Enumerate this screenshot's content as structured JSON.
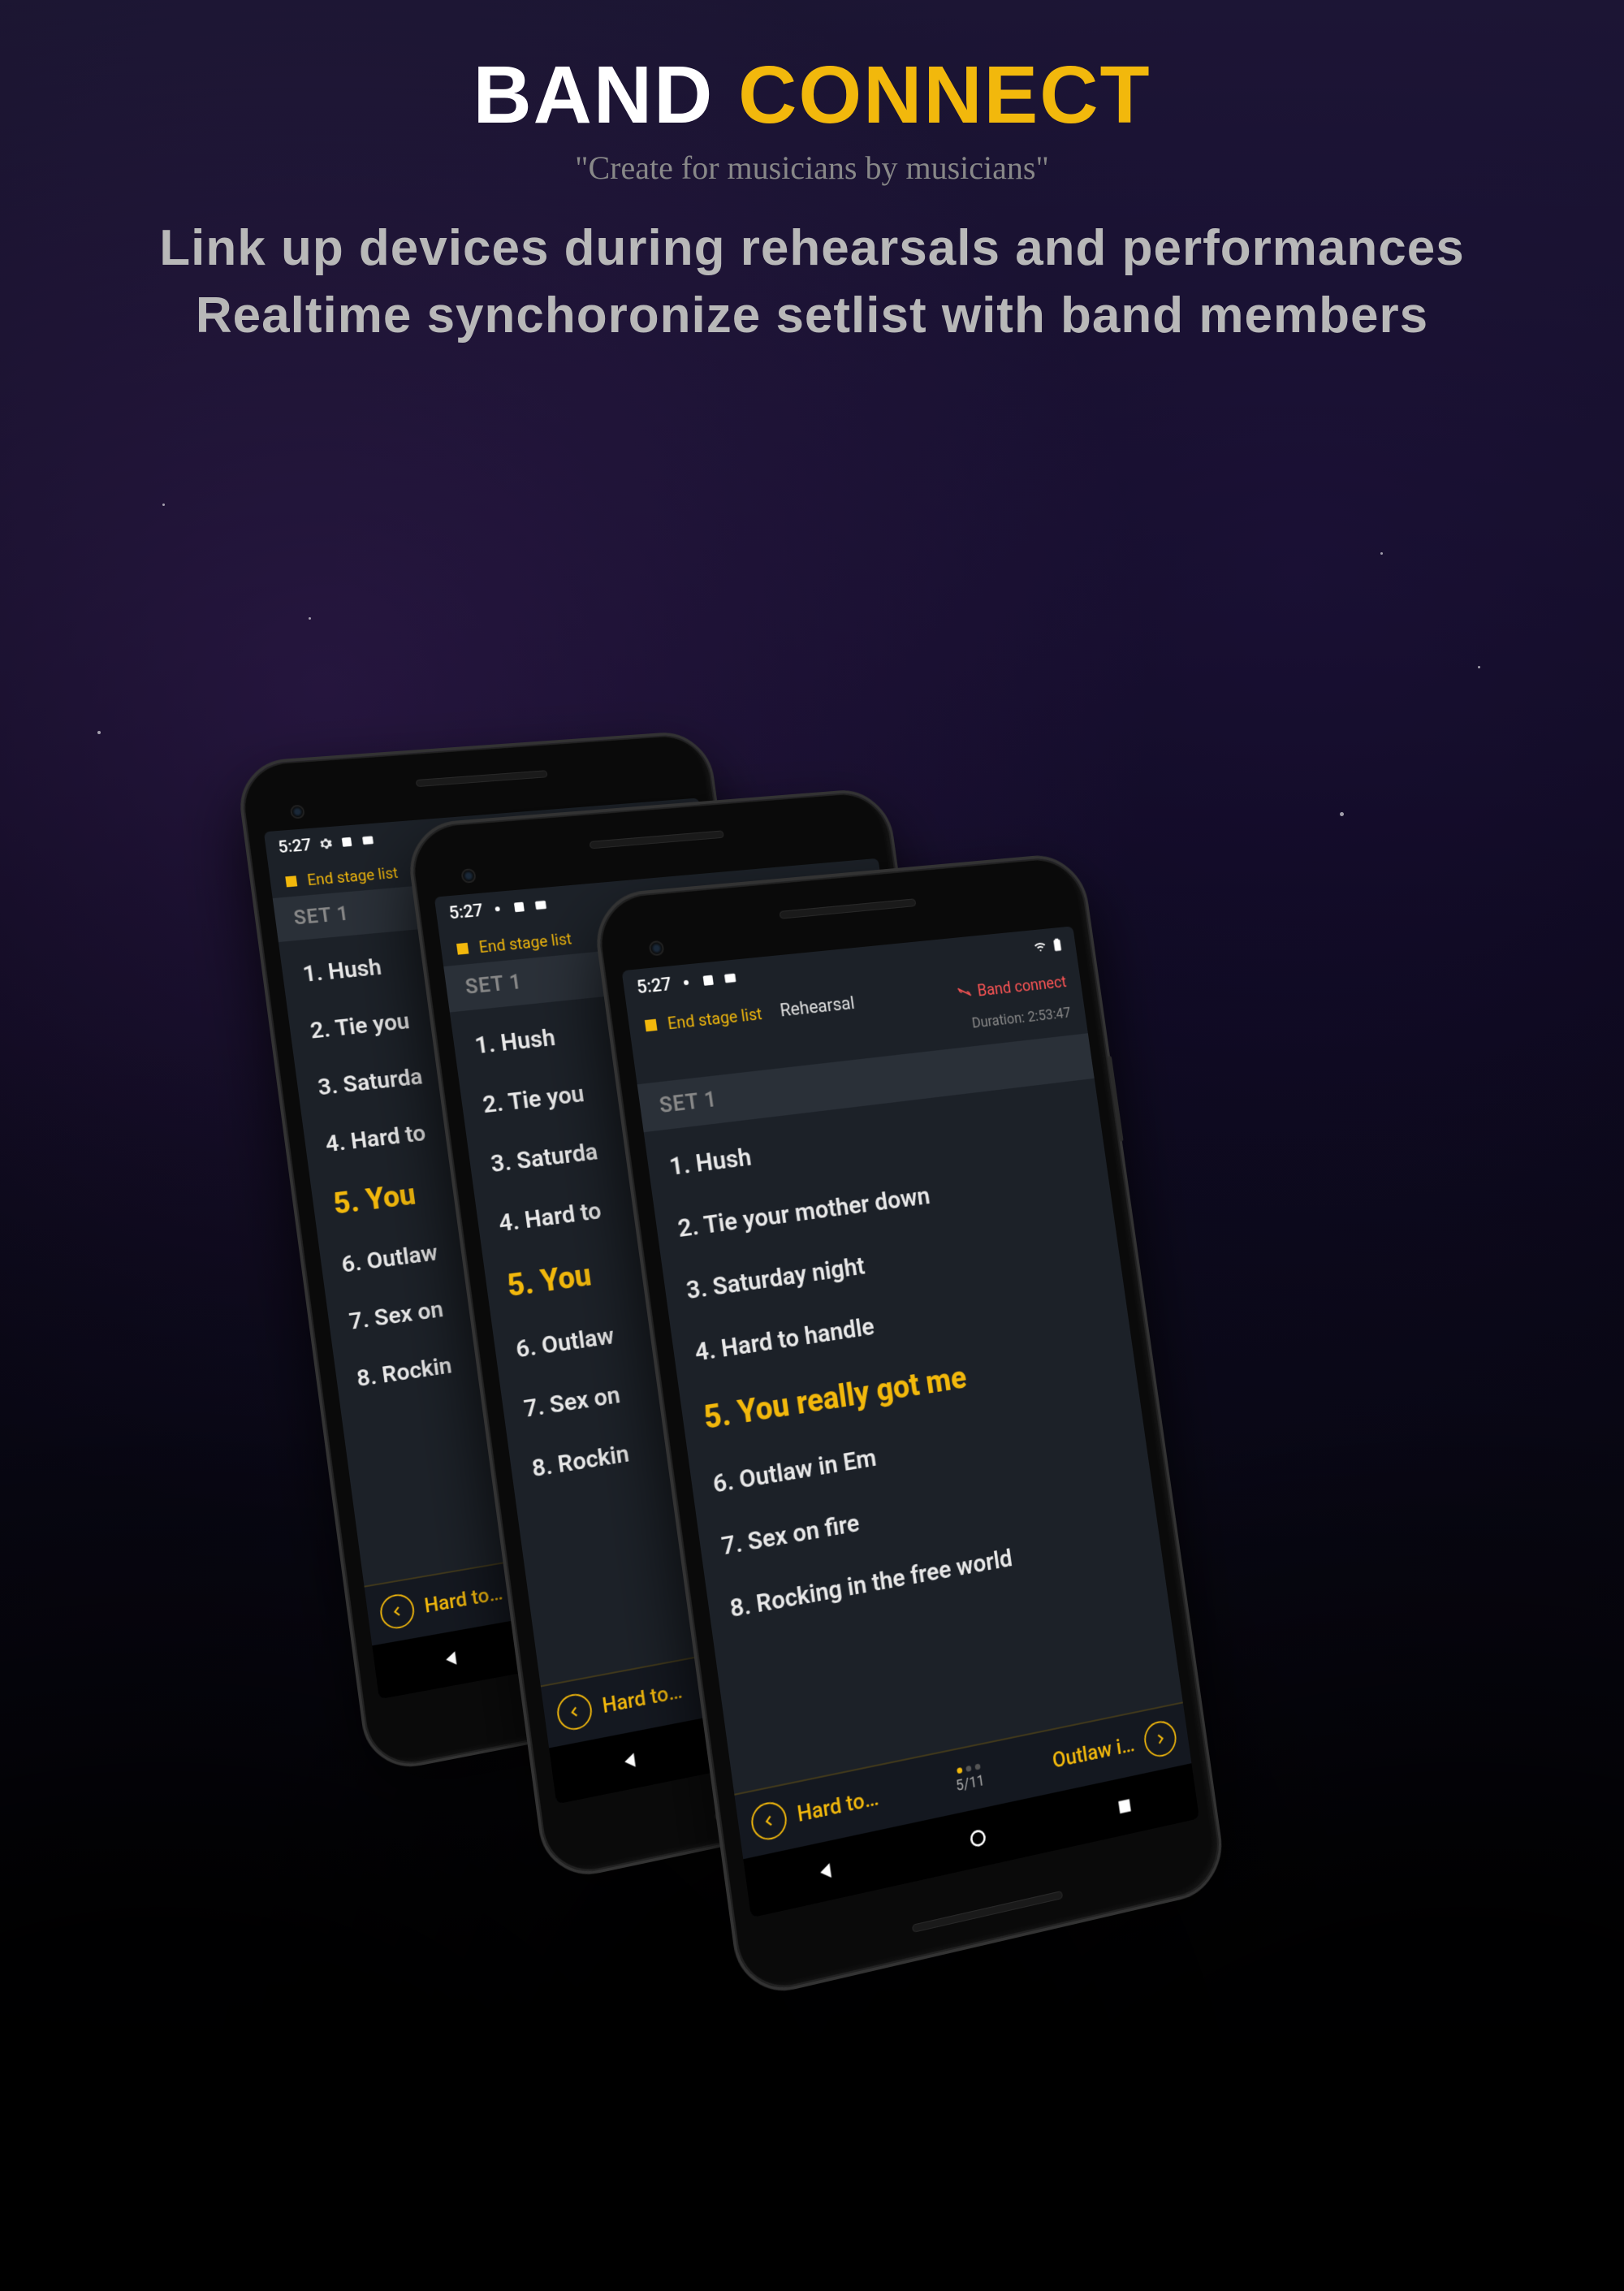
{
  "hero": {
    "title_a": "BAND",
    "title_b": "CONNECT",
    "tagline": "\"Create for musicians by musicians\"",
    "sub1": "Link up devices during rehearsals and performances",
    "sub2": "Realtime synchoronize setlist with band members"
  },
  "phone": {
    "status_time": "5:27",
    "end_stage_label": "End stage list",
    "rehearsal_label": "Rehearsal",
    "band_connect_label": "Band connect",
    "duration_label": "Duration: 2:53:47",
    "set_header": "SET 1",
    "songs": {
      "s1": "1. Hush",
      "s2": "2. Tie your mother down",
      "s2_short": "2. Tie you",
      "s3": "3. Saturday night",
      "s3_short": "3. Saturda",
      "s4": "4. Hard to handle",
      "s4_short": "4. Hard to",
      "s5": "5. You really got me",
      "s5_short": "5. You",
      "s6": "6. Outlaw in Em",
      "s6_short": "6. Outlaw",
      "s7": "7. Sex on fire",
      "s7_short": "7. Sex on",
      "s8": "8. Rocking in the free world",
      "s8_short": "8. Rockin"
    },
    "prev_label": "Hard to…",
    "next_label": "Outlaw i…",
    "pager": "5/11"
  }
}
